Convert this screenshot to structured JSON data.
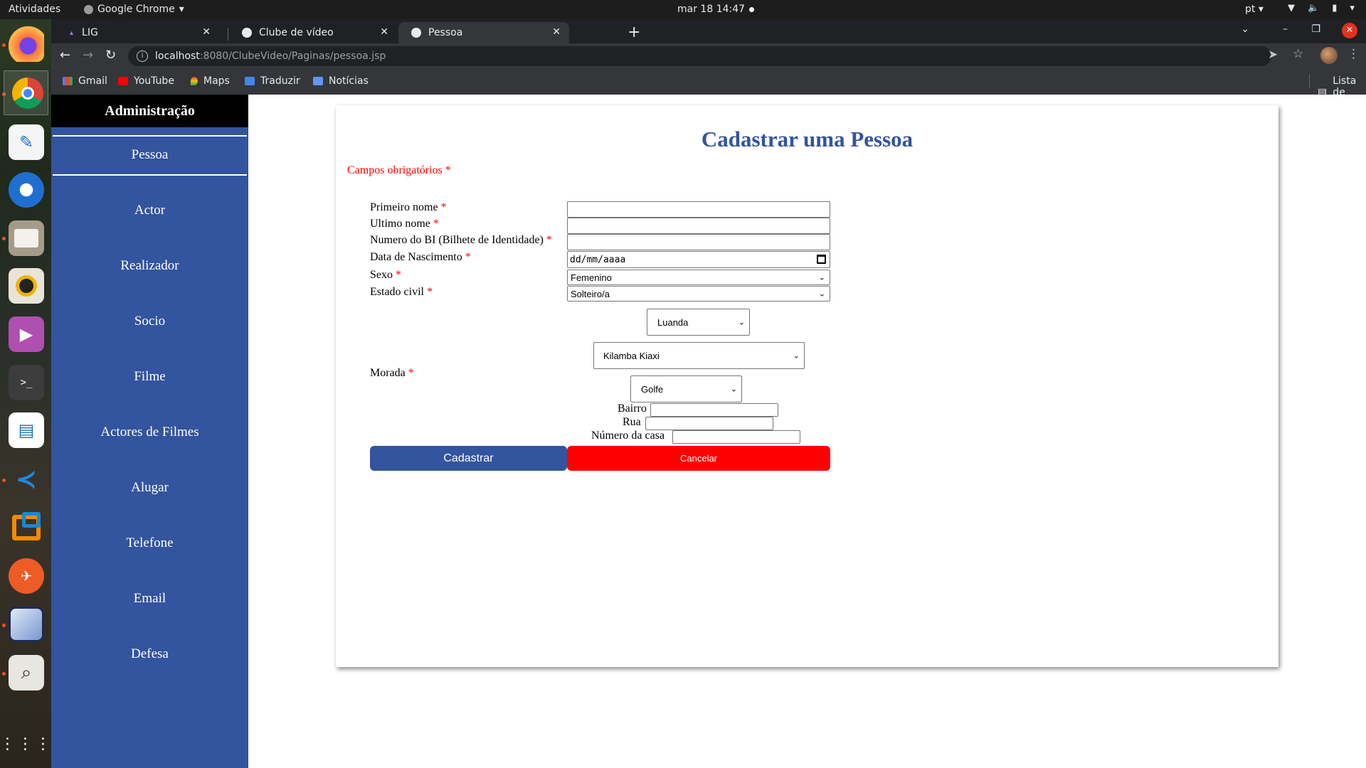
{
  "os": {
    "activities_label": "Atividades",
    "app_name": "Google Chrome",
    "clock": "mar 18  14:47",
    "language": "pt",
    "dock_items": [
      "firefox",
      "chrome",
      "text-editor",
      "thunderbird",
      "files",
      "rhythmbox",
      "media-player",
      "terminal",
      "libreoffice-writer",
      "vscode",
      "virtualbox",
      "postman",
      "cube-app",
      "image-viewer",
      "show-applications"
    ]
  },
  "browser": {
    "tabs": [
      {
        "title": "LIG",
        "active": false
      },
      {
        "title": "Clube de vídeo",
        "active": false
      },
      {
        "title": "Pessoa",
        "active": true
      }
    ],
    "url_host": "localhost",
    "url_rest": ":8080/ClubeVideo/Paginas/pessoa.jsp",
    "bookmarks": [
      "Gmail",
      "YouTube",
      "Maps",
      "Traduzir",
      "Notícias"
    ],
    "reading_list_label": "Lista de leitura"
  },
  "sidebar": {
    "title": "Administração",
    "items": [
      "Pessoa",
      "Actor",
      "Realizador",
      "Socio",
      "Filme",
      "Actores de Filmes",
      "Alugar",
      "Telefone",
      "Email",
      "Defesa"
    ],
    "active_item": "Pessoa"
  },
  "form": {
    "title": "Cadastrar uma Pessoa",
    "required_note": "Campos obrigatórios",
    "required_mark": "*",
    "fields": {
      "first_name_label": "Primeiro nome",
      "last_name_label": "Ultimo nome",
      "bi_label": "Numero do BI (Bilhete de Identidade)",
      "birth_label": "Data de Nascimento",
      "birth_placeholder": "dd/mm/aaaa",
      "sex_label": "Sexo",
      "sex_value": "Femenino",
      "civil_label": "Estado civil",
      "civil_value": "Solteiro/a",
      "address_label": "Morada",
      "province_value": "Luanda",
      "municipality_value": "Kilamba Kiaxi",
      "district_value": "Golfe",
      "bairro_label": "Bairro",
      "rua_label": "Rua",
      "house_label": "Número da casa"
    },
    "submit_label": "Cadastrar",
    "cancel_label": "Cancelar"
  },
  "colors": {
    "brand_blue": "#33549e",
    "cancel_red": "#ff0000",
    "required_red": "#ff0000"
  }
}
